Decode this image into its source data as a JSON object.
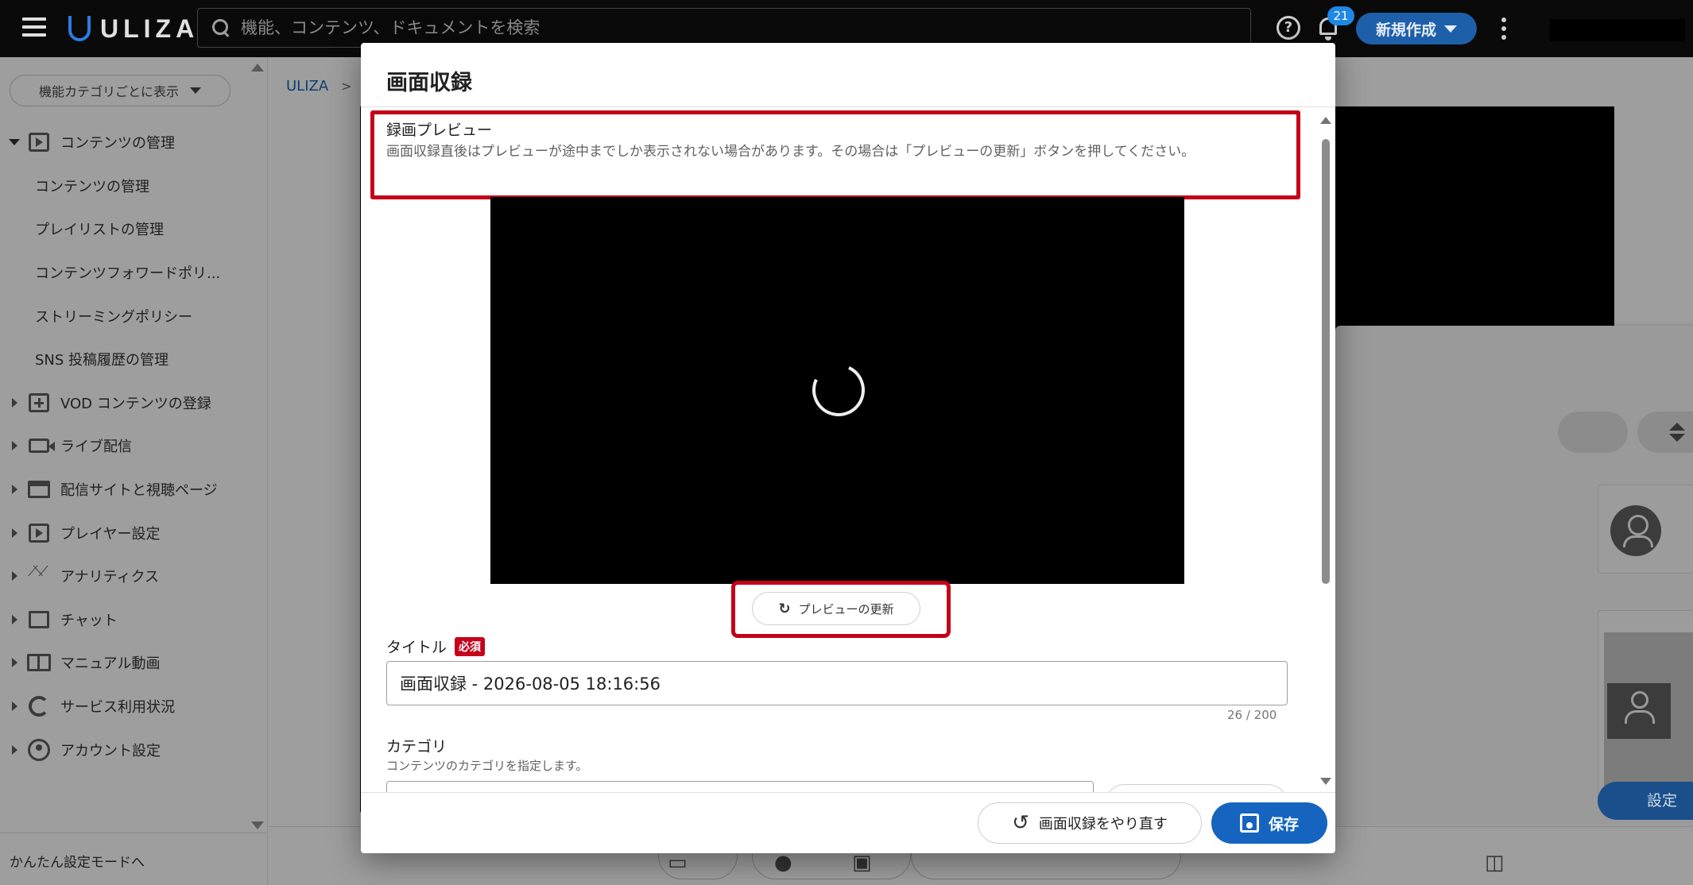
{
  "header": {
    "logo_text": "ULIZA",
    "search_placeholder": "機能、コンテンツ、ドキュメントを検索",
    "notification_count": "21",
    "new_button_label": "新規作成"
  },
  "sidebar": {
    "category_select": "機能カテゴリごとに表示",
    "items": [
      {
        "label": "コンテンツの管理",
        "icon": "play-box-icon",
        "expanded": true
      },
      {
        "label": "コンテンツの管理",
        "sub": true
      },
      {
        "label": "プレイリストの管理",
        "sub": true
      },
      {
        "label": "コンテンツフォワードポリ...",
        "sub": true
      },
      {
        "label": "ストリーミングポリシー",
        "sub": true
      },
      {
        "label": "SNS 投稿履歴の管理",
        "sub": true
      },
      {
        "label": "VOD コンテンツの登録",
        "icon": "add-box-icon"
      },
      {
        "label": "ライブ配信",
        "icon": "video-camera-icon"
      },
      {
        "label": "配信サイトと視聴ページ",
        "icon": "website-icon"
      },
      {
        "label": "プレイヤー設定",
        "icon": "player-settings-icon"
      },
      {
        "label": "アナリティクス",
        "icon": "analytics-icon"
      },
      {
        "label": "チャット",
        "icon": "chat-icon"
      },
      {
        "label": "マニュアル動画",
        "icon": "manual-book-icon"
      },
      {
        "label": "サービス利用状況",
        "icon": "usage-ring-icon"
      },
      {
        "label": "アカウント設定",
        "icon": "account-icon"
      }
    ],
    "easy_mode_link": "かんたん設定モードへ"
  },
  "background": {
    "breadcrumb_root": "ULIZA",
    "settings_button": "設定"
  },
  "modal": {
    "title": "画面収録",
    "preview": {
      "heading": "録画プレビュー",
      "description": "画面収録直後はプレビューが途中までしか表示されない場合があります。その場合は「プレビューの更新」ボタンを押してください。",
      "refresh_button": "プレビューの更新"
    },
    "title_field": {
      "label": "タイトル",
      "required_badge": "必須",
      "value": "画面収録 - 2026-08-05 18:16:56",
      "counter": "26 / 200"
    },
    "category_field": {
      "label": "カテゴリ",
      "description": "コンテンツのカテゴリを指定します。"
    },
    "footer": {
      "redo_button": "画面収録をやり直す",
      "save_button": "保存"
    }
  },
  "colors": {
    "highlight": "#c4001a",
    "primary": "#1565c0",
    "topbar": "#0a0a0a"
  }
}
